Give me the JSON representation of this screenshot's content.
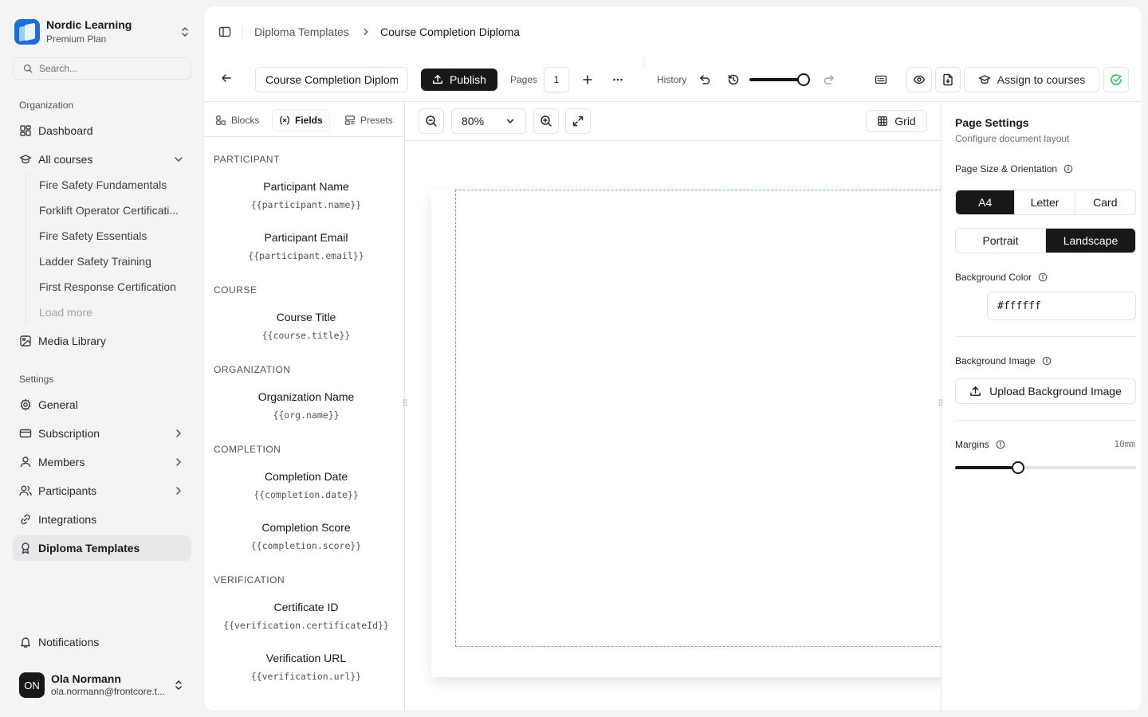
{
  "org": {
    "name": "Nordic Learning",
    "plan": "Premium Plan"
  },
  "search": {
    "placeholder": "Search..."
  },
  "sidebar": {
    "section_org": "Organization",
    "dashboard": "Dashboard",
    "all_courses": "All courses",
    "courses": [
      "Fire Safety Fundamentals",
      "Forklift Operator Certificati...",
      "Fire Safety Essentials",
      "Ladder Safety Training",
      "First Response Certification"
    ],
    "load_more": "Load more",
    "media_library": "Media Library",
    "section_settings": "Settings",
    "general": "General",
    "subscription": "Subscription",
    "members": "Members",
    "participants": "Participants",
    "integrations": "Integrations",
    "diploma_templates": "Diploma Templates",
    "notifications": "Notifications"
  },
  "user": {
    "initials": "ON",
    "name": "Ola Normann",
    "email": "ola.normann@frontcore.t..."
  },
  "breadcrumb": {
    "parent": "Diploma Templates",
    "current": "Course Completion Diploma"
  },
  "toolbar": {
    "title_value": "Course Completion Diploma",
    "publish": "Publish",
    "pages_label": "Pages",
    "pages_value": "1",
    "history_label": "History",
    "history_level": 0.95,
    "assign": "Assign to courses"
  },
  "left_panel": {
    "tabs": {
      "blocks": "Blocks",
      "fields": "Fields",
      "presets": "Presets"
    },
    "groups": {
      "participant": "PARTICIPANT",
      "course": "COURSE",
      "organization": "ORGANIZATION",
      "completion": "COMPLETION",
      "verification": "VERIFICATION"
    },
    "fields": {
      "participant_name": {
        "name": "Participant Name",
        "var": "{{participant.name}}"
      },
      "participant_email": {
        "name": "Participant Email",
        "var": "{{participant.email}}"
      },
      "course_title": {
        "name": "Course Title",
        "var": "{{course.title}}"
      },
      "org_name": {
        "name": "Organization Name",
        "var": "{{org.name}}"
      },
      "completion_date": {
        "name": "Completion Date",
        "var": "{{completion.date}}"
      },
      "completion_score": {
        "name": "Completion Score",
        "var": "{{completion.score}}"
      },
      "certificate_id": {
        "name": "Certificate ID",
        "var": "{{verification.certificateId}}"
      },
      "verification_url": {
        "name": "Verification URL",
        "var": "{{verification.url}}"
      }
    }
  },
  "canvas": {
    "zoom": "80%",
    "grid": "Grid"
  },
  "page_settings": {
    "title": "Page Settings",
    "subtitle": "Configure document layout",
    "size_label": "Page Size & Orientation",
    "sizes": [
      "A4",
      "Letter",
      "Card"
    ],
    "orientations": [
      "Portrait",
      "Landscape"
    ],
    "bg_color_label": "Background Color",
    "bg_color_value": "#ffffff",
    "bg_image_label": "Background Image",
    "upload": "Upload Background Image",
    "margins_label": "Margins",
    "margins_value": "10mm",
    "margins_level": 0.35
  },
  "colors": {
    "accent": "#18181b",
    "success": "#22c55e",
    "guide": "#6ea9d7"
  }
}
